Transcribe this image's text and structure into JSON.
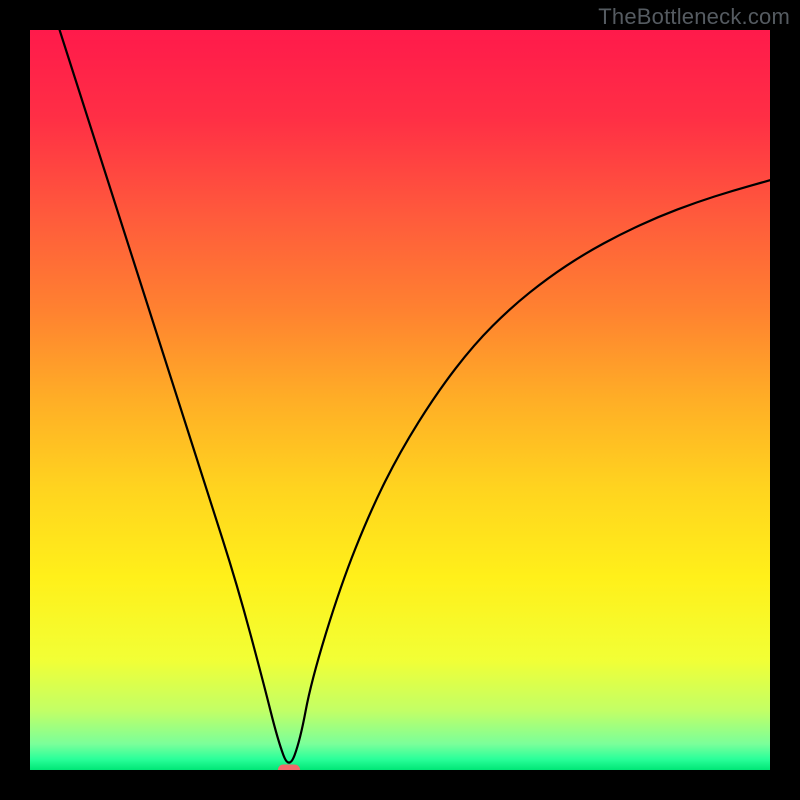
{
  "watermark": "TheBottleneck.com",
  "chart_data": {
    "type": "line",
    "title": "",
    "xlabel": "",
    "ylabel": "",
    "xlim": [
      0,
      100
    ],
    "ylim": [
      0,
      100
    ],
    "grid": false,
    "legend": false,
    "background": {
      "type": "vertical-gradient",
      "stops": [
        {
          "pos": 0.0,
          "color": "#ff1a4b"
        },
        {
          "pos": 0.12,
          "color": "#ff2f45"
        },
        {
          "pos": 0.25,
          "color": "#ff5a3c"
        },
        {
          "pos": 0.38,
          "color": "#ff8230"
        },
        {
          "pos": 0.5,
          "color": "#ffae26"
        },
        {
          "pos": 0.62,
          "color": "#ffd41f"
        },
        {
          "pos": 0.74,
          "color": "#fff01a"
        },
        {
          "pos": 0.85,
          "color": "#f2ff35"
        },
        {
          "pos": 0.92,
          "color": "#c2ff66"
        },
        {
          "pos": 0.965,
          "color": "#7aff9a"
        },
        {
          "pos": 0.985,
          "color": "#2bff9a"
        },
        {
          "pos": 1.0,
          "color": "#00e676"
        }
      ]
    },
    "series": [
      {
        "name": "bottleneck-curve",
        "stroke": "#000000",
        "strokeWidth": 2.2,
        "x": [
          4.0,
          8.0,
          12.0,
          16.0,
          20.0,
          24.0,
          28.0,
          31.5,
          33.5,
          35.0,
          36.5,
          38.0,
          42.0,
          46.0,
          50.0,
          55.0,
          60.0,
          65.0,
          70.0,
          75.0,
          80.0,
          85.0,
          90.0,
          95.0,
          100.0
        ],
        "y": [
          100.0,
          87.5,
          75.0,
          62.5,
          50.0,
          37.5,
          25.0,
          12.0,
          4.0,
          0.0,
          4.0,
          12.0,
          25.0,
          35.0,
          43.0,
          51.0,
          57.5,
          62.5,
          66.5,
          69.8,
          72.5,
          74.8,
          76.7,
          78.3,
          79.7
        ]
      }
    ],
    "markers": [
      {
        "name": "min-marker",
        "shape": "rounded-rect",
        "cx": 35.0,
        "cy": 0.0,
        "w": 3.0,
        "h": 1.5,
        "fill": "#f26a6a"
      }
    ]
  }
}
